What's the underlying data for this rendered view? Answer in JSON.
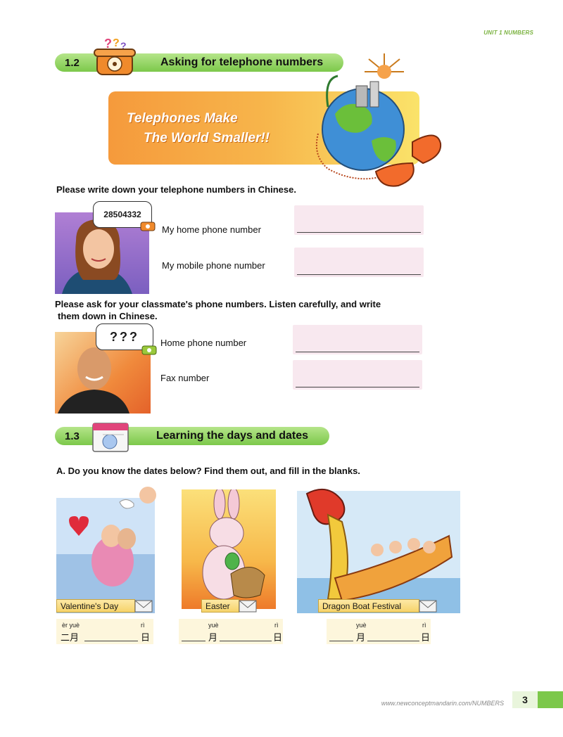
{
  "header": {
    "unit": "UNIT 1 NUMBERS"
  },
  "section_12": {
    "number": "1.2",
    "title": "Asking for telephone numbers",
    "banner_line1": "Telephones Make",
    "banner_line2": "The World Smaller!!",
    "instruction": "Please write down your telephone numbers in Chinese.",
    "speech_number": "28504332",
    "field_home": "My home phone number",
    "field_mobile": "My mobile phone number",
    "instruction2_line1": "Please ask for your classmate's phone numbers. Listen carefully, and write",
    "instruction2_line2": "them down in Chinese.",
    "speech_question": "???",
    "field_classmate_home": "Home phone number",
    "field_fax": "Fax number"
  },
  "section_13": {
    "number": "1.3",
    "title": "Learning the days and dates",
    "instruction": "A. Do you know the dates below? Find them out, and fill in the blanks.",
    "holidays": [
      {
        "label": "Valentine's Day",
        "pinyin_month": "èr yuè",
        "pinyin_day": "rì",
        "month_char": "二月",
        "day_char": "日"
      },
      {
        "label": "Easter",
        "pinyin_month": "yuè",
        "pinyin_day": "rì",
        "month_char": "月",
        "day_char": "日"
      },
      {
        "label": "Dragon Boat Festival",
        "pinyin_month": "yuè",
        "pinyin_day": "rì",
        "month_char": "月",
        "day_char": "日"
      }
    ]
  },
  "footer": {
    "url": "www.newconceptmandarin.com/NUMBERS",
    "page": "3"
  },
  "colors": {
    "accent_green": "#7cc84a",
    "banner_orange": "#f59a3c",
    "answer_pink": "#f8e8ef"
  }
}
